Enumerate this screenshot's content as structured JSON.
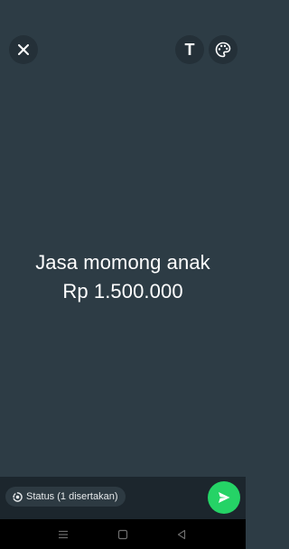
{
  "status_text": {
    "line1": "Jasa momong anak",
    "line2": "Rp 1.500.000"
  },
  "top_bar": {
    "close_icon": "close-icon",
    "text_icon": "text-icon",
    "text_glyph": "T",
    "palette_icon": "palette-icon"
  },
  "audience": {
    "label": "Status (1 disertakan)",
    "icon": "status-ring-icon"
  },
  "send": {
    "icon": "send-icon",
    "color": "#25d366"
  },
  "system_nav": {
    "menu_icon": "recent-apps-icon",
    "home_icon": "home-icon",
    "back_icon": "back-icon"
  },
  "colors": {
    "background": "#2d3c45",
    "bottom_bar": "#1c262d",
    "accent": "#25d366"
  }
}
